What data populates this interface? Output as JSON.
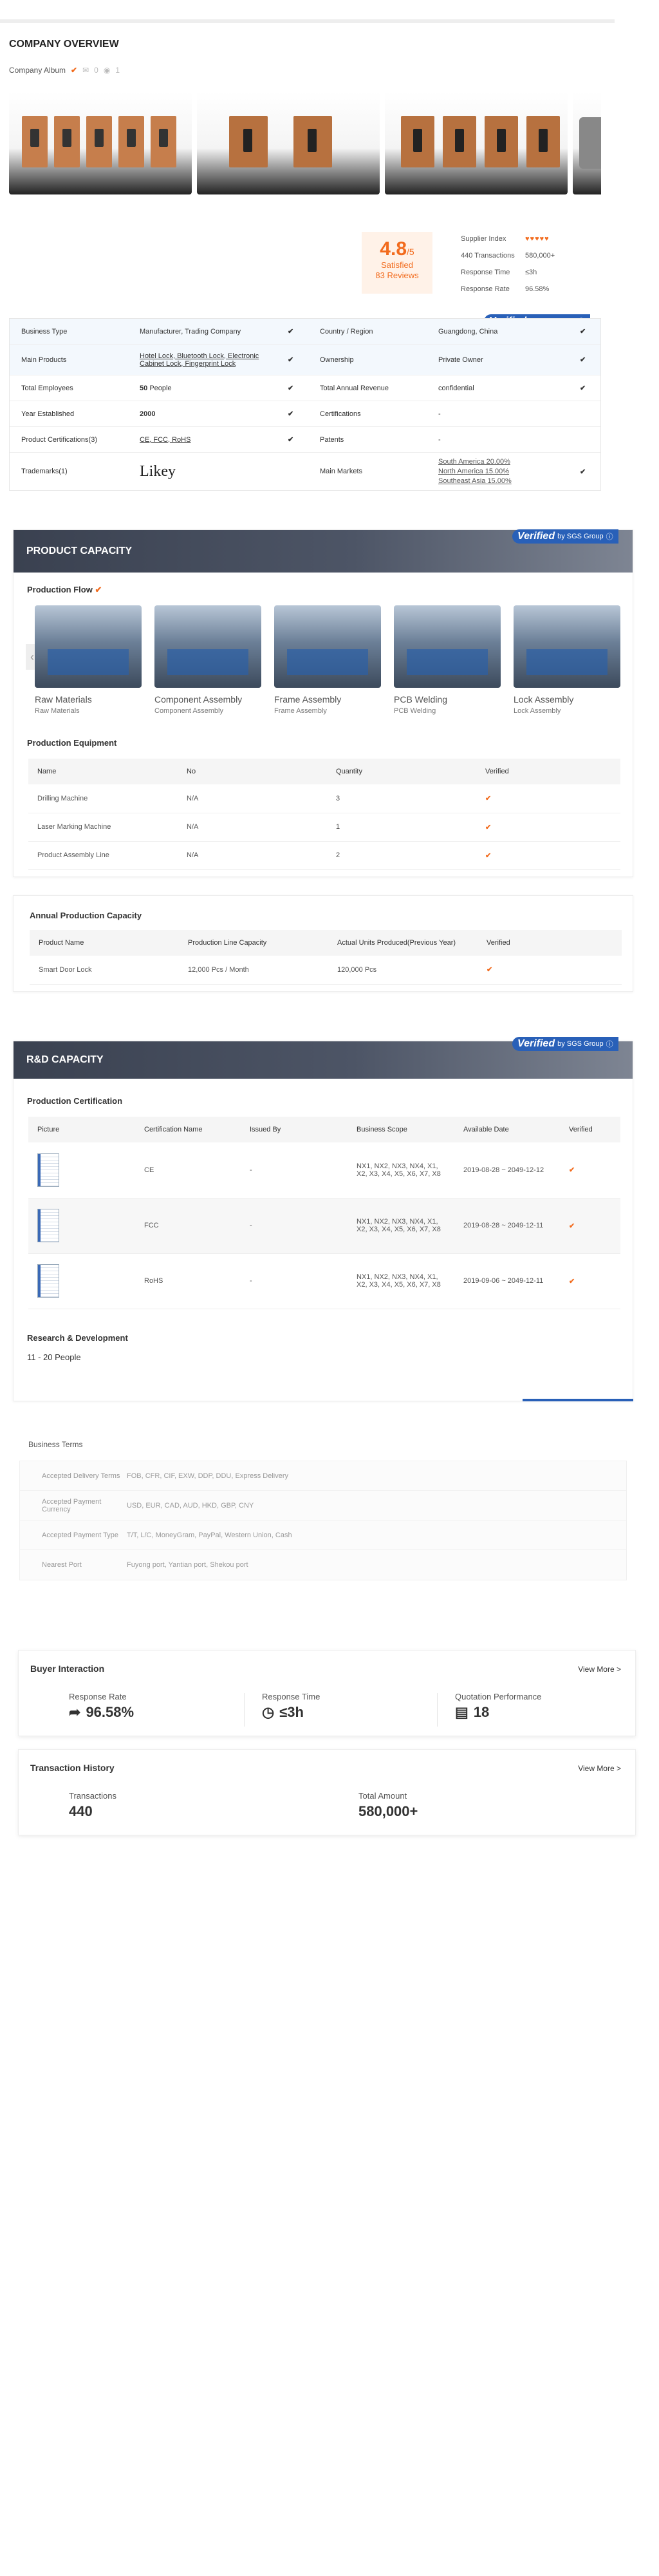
{
  "page": {
    "title": "COMPANY OVERVIEW"
  },
  "album": {
    "label": "Company Album",
    "mail_count": "0",
    "view_count": "1"
  },
  "rating": {
    "score": "4.8",
    "out_of": "/5",
    "satisfied": "Satisfied",
    "reviews": "83 Reviews"
  },
  "stats": [
    {
      "label": "Supplier Index",
      "value": "♥♥♥♥♥"
    },
    {
      "label": "440 Transactions",
      "value": "580,000+"
    },
    {
      "label": "Response Time",
      "value": "≤3h"
    },
    {
      "label": "Response Rate",
      "value": "96.58%"
    }
  ],
  "sgs": {
    "verified": "Verified",
    "by": "by SGS Group"
  },
  "info": {
    "business_type_label": "Business Type",
    "business_type": "Manufacturer, Trading Company",
    "country_label": "Country / Region",
    "country": "Guangdong, China",
    "main_products_label": "Main Products",
    "main_products": "Hotel Lock, Bluetooth Lock, Electronic Cabinet Lock, Fingerprint Lock",
    "ownership_label": "Ownership",
    "ownership": "Private Owner",
    "employees_label": "Total Employees",
    "employees": "50",
    "employees_unit": "People",
    "revenue_label": "Total Annual Revenue",
    "revenue": "confidential",
    "year_label": "Year Established",
    "year": "2000",
    "certifications_label": "Certifications",
    "certifications": "-",
    "product_certs_label": "Product Certifications(3)",
    "product_certs": "CE, FCC, RoHS",
    "patents_label": "Patents",
    "patents": "-",
    "trademarks_label": "Trademarks(1)",
    "trademark": "Likey",
    "markets_label": "Main Markets",
    "market_1": "South America 20.00%",
    "market_2": "North America 15.00%",
    "market_3": "Southeast Asia 15.00%"
  },
  "capacity": {
    "banner": "PRODUCT CAPACITY",
    "flow_title": "Production Flow",
    "flow": [
      {
        "title": "Raw Materials",
        "sub": "Raw Materials"
      },
      {
        "title": "Component Assembly",
        "sub": "Component Assembly"
      },
      {
        "title": "Frame Assembly",
        "sub": "Frame Assembly"
      },
      {
        "title": "PCB Welding",
        "sub": "PCB Welding"
      },
      {
        "title": "Lock Assembly",
        "sub": "Lock Assembly"
      }
    ],
    "equipment_title": "Production Equipment",
    "equipment_headers": [
      "Name",
      "No",
      "Quantity",
      "Verified"
    ],
    "equipment": [
      {
        "name": "Drilling Machine",
        "no": "N/A",
        "qty": "3"
      },
      {
        "name": "Laser Marking Machine",
        "no": "N/A",
        "qty": "1"
      },
      {
        "name": "Product Assembly Line",
        "no": "N/A",
        "qty": "2"
      }
    ],
    "annual_title": "Annual Production Capacity",
    "annual_headers": [
      "Product Name",
      "Production Line Capacity",
      "Actual Units Produced(Previous Year)",
      "Verified"
    ],
    "annual": {
      "name": "Smart Door Lock",
      "capacity": "12,000 Pcs / Month",
      "actual": "120,000 Pcs"
    }
  },
  "rd": {
    "banner": "R&D CAPACITY",
    "cert_title": "Production Certification",
    "headers": [
      "Picture",
      "Certification Name",
      "Issued By",
      "Business Scope",
      "Available Date",
      "Verified"
    ],
    "rows": [
      {
        "name": "CE",
        "issued": "-",
        "scope": "NX1, NX2, NX3, NX4, X1, X2, X3, X4, X5, X6, X7, X8",
        "date": "2019-08-28 ~ 2049-12-12"
      },
      {
        "name": "FCC",
        "issued": "-",
        "scope": "NX1, NX2, NX3, NX4, X1, X2, X3, X4, X5, X6, X7, X8",
        "date": "2019-08-28 ~ 2049-12-11"
      },
      {
        "name": "RoHS",
        "issued": "-",
        "scope": "NX1, NX2, NX3, NX4, X1, X2, X3, X4, X5, X6, X7, X8",
        "date": "2019-09-06 ~ 2049-12-11"
      }
    ],
    "research_title": "Research & Development",
    "research_value": "11 - 20 People"
  },
  "terms": {
    "title": "Business Terms",
    "rows": [
      {
        "k": "Accepted Delivery Terms",
        "v": "FOB, CFR, CIF, EXW, DDP, DDU, Express Delivery"
      },
      {
        "k": "Accepted Payment Currency",
        "v": "USD, EUR, CAD, AUD, HKD, GBP, CNY"
      },
      {
        "k": "Accepted Payment Type",
        "v": "T/T, L/C, MoneyGram, PayPal, Western Union, Cash"
      },
      {
        "k": "Nearest Port",
        "v": "Fuyong port, Yantian port, Shekou port"
      }
    ]
  },
  "buyer": {
    "title": "Buyer Interaction",
    "more": "View More >",
    "response_rate_label": "Response Rate",
    "response_rate": "96.58%",
    "response_time_label": "Response Time",
    "response_time": "≤3h",
    "quotation_label": "Quotation Performance",
    "quotation": "18"
  },
  "history": {
    "title": "Transaction History",
    "more": "View More >",
    "transactions_label": "Transactions",
    "transactions": "440",
    "amount_label": "Total Amount",
    "amount": "580,000+"
  }
}
